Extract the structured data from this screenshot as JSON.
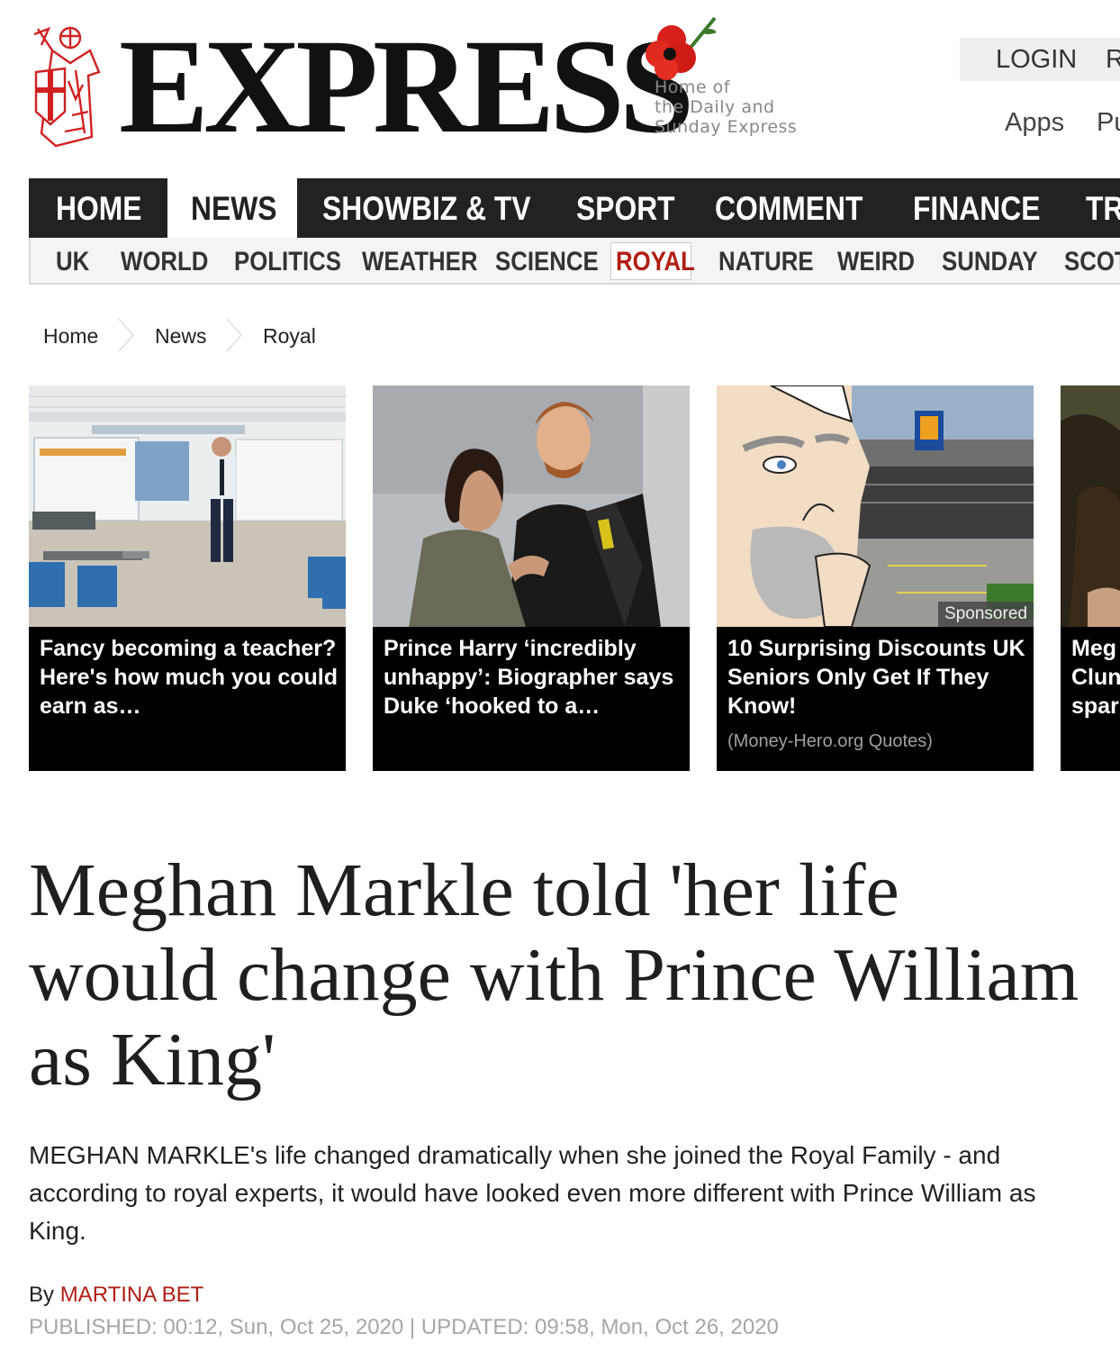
{
  "masthead": {
    "brand": "EXPRESS",
    "tagline": [
      "Home of",
      "the Daily and",
      "Sunday Express"
    ],
    "login": "LOGIN",
    "login_next": "R",
    "apps": "Apps",
    "partial_link": "Pu"
  },
  "main_nav": [
    "HOME",
    "NEWS",
    "SHOWBIZ & TV",
    "SPORT",
    "COMMENT",
    "FINANCE",
    "TR"
  ],
  "main_nav_active": "NEWS",
  "sub_nav": [
    "UK",
    "WORLD",
    "POLITICS",
    "WEATHER",
    "SCIENCE",
    "ROYAL",
    "NATURE",
    "WEIRD",
    "SUNDAY",
    "SCOTL"
  ],
  "sub_nav_active": "ROYAL",
  "breadcrumb": [
    "Home",
    "News",
    "Royal"
  ],
  "cards": [
    {
      "title": "Fancy becoming a teacher? Here's how much you could earn as…",
      "image": "classroom-teacher-photo"
    },
    {
      "title": "Prince Harry ‘incredibly unhappy’: Biographer says Duke ‘hooked to a…",
      "image": "harry-meghan-photo"
    },
    {
      "title": "10 Surprising Discounts UK Seniors Only Get If They Know!",
      "image": "supermarket-cartoon-ad",
      "badge": "Sponsored",
      "source": "(Money-Hero.org Quotes)"
    },
    {
      "title_lines": [
        "Meg",
        "Clun",
        "spar"
      ],
      "image": "partial-photo"
    }
  ],
  "article": {
    "headline": "Meghan Markle told 'her life would change with Prince William as King'",
    "standfirst": "MEGHAN MARKLE's life changed dramatically when she joined the Royal Family - and according to royal experts, it would have looked even more different with Prince William as King.",
    "by_label": "By",
    "author": "MARTINA BET",
    "dates": "PUBLISHED: 00:12, Sun, Oct 25, 2020 | UPDATED: 09:58, Mon, Oct 26, 2020"
  },
  "colors": {
    "accent_red": "#b01e14",
    "nav_bg": "#222222",
    "subnav_bg": "#f4f4f4",
    "meta_grey": "#a6a6a6"
  }
}
